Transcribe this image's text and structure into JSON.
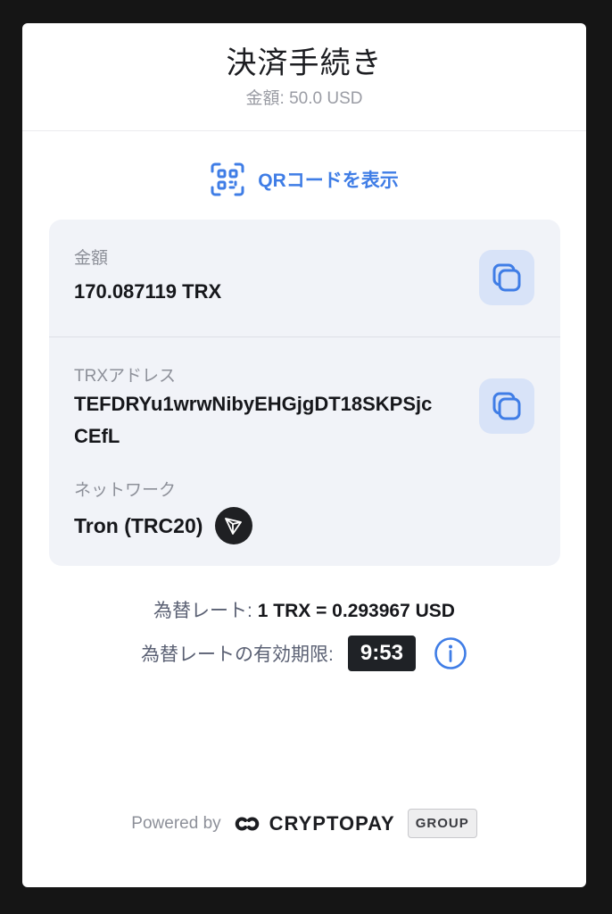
{
  "header": {
    "title": "決済手続き",
    "subtitle": "金額: 50.0 USD"
  },
  "qr_button": {
    "label": "QRコードを表示",
    "icon": "qr-scan-icon"
  },
  "amount": {
    "label": "金額",
    "value": "170.087119 TRX",
    "copy_icon": "copy-icon"
  },
  "address": {
    "label": "TRXアドレス",
    "line1": "TEFDRYu1wrwNibyEHGjgDT18SKPSjc",
    "line2": "CEfL",
    "copy_icon": "copy-icon"
  },
  "network": {
    "label": "ネットワーク",
    "value": "Tron (TRC20)",
    "icon": "tron-logo-icon"
  },
  "rate": {
    "label": "為替レート:",
    "value": "1 TRX = 0.293967 USD"
  },
  "expiry": {
    "label": "為替レートの有効期限:",
    "timer": "9:53",
    "info_icon": "info-icon"
  },
  "footer": {
    "powered": "Powered by",
    "brand": "CRYPTOPAY",
    "group": "GROUP"
  },
  "colors": {
    "accent": "#3f7de6",
    "copy_bg": "#d8e3f8",
    "panel_bg": "#f1f3f8",
    "timer_bg": "#1f2226"
  }
}
